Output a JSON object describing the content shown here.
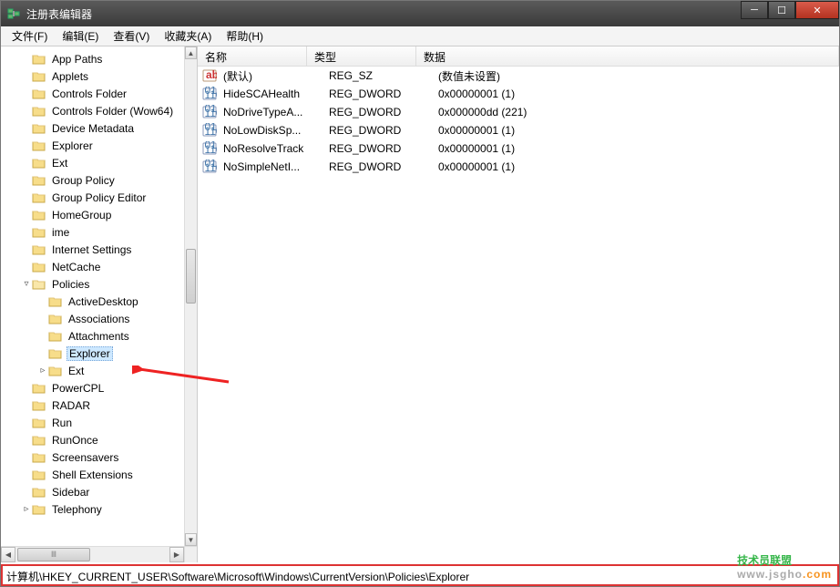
{
  "window": {
    "title": "注册表编辑器"
  },
  "menu": {
    "file": "文件(F)",
    "edit": "编辑(E)",
    "view": "查看(V)",
    "fav": "收藏夹(A)",
    "help": "帮助(H)"
  },
  "tree": [
    {
      "level": 0,
      "tw": "",
      "label": "App Paths"
    },
    {
      "level": 0,
      "tw": "",
      "label": "Applets"
    },
    {
      "level": 0,
      "tw": "",
      "label": "Controls Folder"
    },
    {
      "level": 0,
      "tw": "",
      "label": "Controls Folder (Wow64)"
    },
    {
      "level": 0,
      "tw": "",
      "label": "Device Metadata"
    },
    {
      "level": 0,
      "tw": "",
      "label": "Explorer"
    },
    {
      "level": 0,
      "tw": "",
      "label": "Ext"
    },
    {
      "level": 0,
      "tw": "",
      "label": "Group Policy"
    },
    {
      "level": 0,
      "tw": "",
      "label": "Group Policy Editor"
    },
    {
      "level": 0,
      "tw": "",
      "label": "HomeGroup"
    },
    {
      "level": 0,
      "tw": "",
      "label": "ime"
    },
    {
      "level": 0,
      "tw": "",
      "label": "Internet Settings"
    },
    {
      "level": 0,
      "tw": "",
      "label": "NetCache"
    },
    {
      "level": 0,
      "tw": "▿",
      "label": "Policies",
      "open": true
    },
    {
      "level": 1,
      "tw": "",
      "label": "ActiveDesktop"
    },
    {
      "level": 1,
      "tw": "",
      "label": "Associations"
    },
    {
      "level": 1,
      "tw": "",
      "label": "Attachments"
    },
    {
      "level": 1,
      "tw": "",
      "label": "Explorer",
      "sel": true
    },
    {
      "level": 1,
      "tw": "▹",
      "label": "Ext"
    },
    {
      "level": 0,
      "tw": "",
      "label": "PowerCPL"
    },
    {
      "level": 0,
      "tw": "",
      "label": "RADAR"
    },
    {
      "level": 0,
      "tw": "",
      "label": "Run"
    },
    {
      "level": 0,
      "tw": "",
      "label": "RunOnce"
    },
    {
      "level": 0,
      "tw": "",
      "label": "Screensavers"
    },
    {
      "level": 0,
      "tw": "",
      "label": "Shell Extensions"
    },
    {
      "level": 0,
      "tw": "",
      "label": "Sidebar"
    },
    {
      "level": 0,
      "tw": "▹",
      "label": "Telephony"
    }
  ],
  "list_head": {
    "name": "名称",
    "type": "类型",
    "data": "数据"
  },
  "rows": [
    {
      "icon": "str",
      "name": "(默认)",
      "type": "REG_SZ",
      "data": "(数值未设置)"
    },
    {
      "icon": "bin",
      "name": "HideSCAHealth",
      "type": "REG_DWORD",
      "data": "0x00000001 (1)"
    },
    {
      "icon": "bin",
      "name": "NoDriveTypeA...",
      "type": "REG_DWORD",
      "data": "0x000000dd (221)"
    },
    {
      "icon": "bin",
      "name": "NoLowDiskSp...",
      "type": "REG_DWORD",
      "data": "0x00000001 (1)"
    },
    {
      "icon": "bin",
      "name": "NoResolveTrack",
      "type": "REG_DWORD",
      "data": "0x00000001 (1)"
    },
    {
      "icon": "bin",
      "name": "NoSimpleNetI...",
      "type": "REG_DWORD",
      "data": "0x00000001 (1)"
    }
  ],
  "status": "计算机\\HKEY_CURRENT_USER\\Software\\Microsoft\\Windows\\CurrentVersion\\Policies\\Explorer",
  "hscroll_thumb": "Ⅲ",
  "watermark": {
    "zh": "技术员联盟",
    "url1": "www.jsgho",
    "url2": ".com"
  }
}
